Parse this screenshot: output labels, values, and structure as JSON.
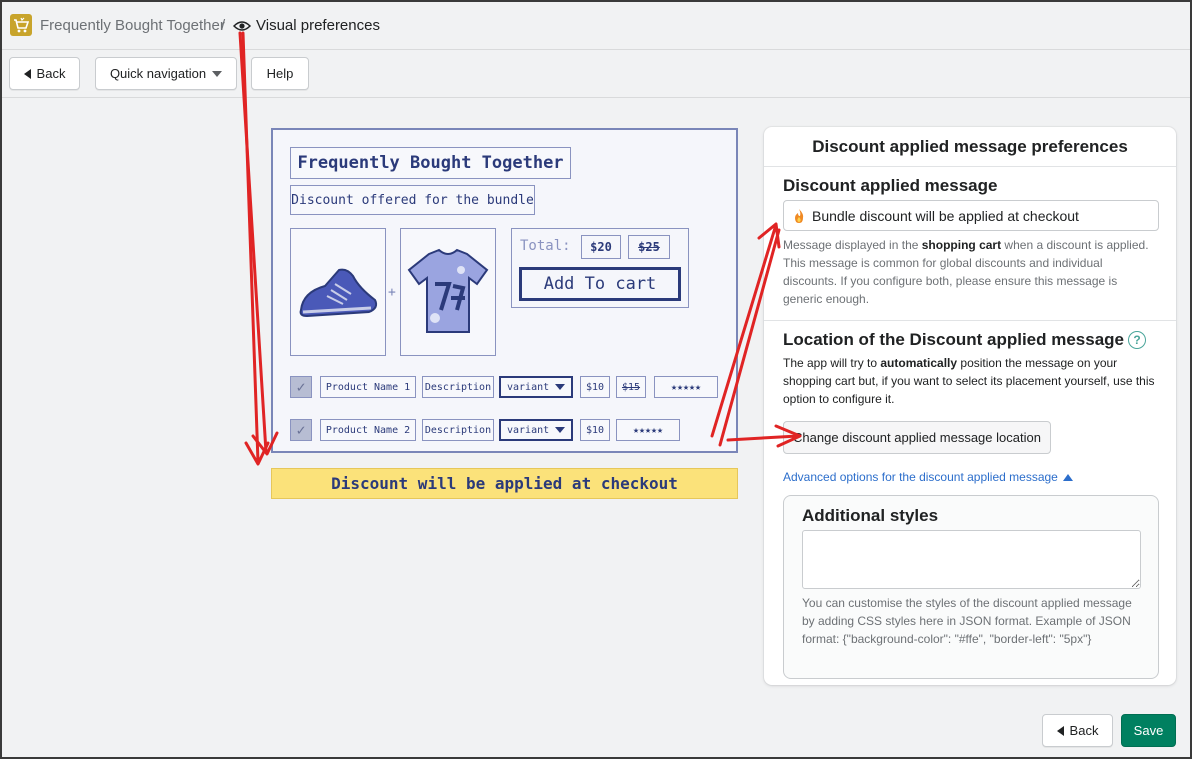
{
  "breadcrumb": {
    "app_name": "Frequently Bought Together",
    "separator": "/",
    "page_name": "Visual preferences"
  },
  "toolbar": {
    "back_label": "Back",
    "quick_nav_label": "Quick navigation",
    "help_label": "Help"
  },
  "preview": {
    "title": "Frequently Bought Together",
    "subtitle": "Discount offered for the bundle",
    "plus": "+",
    "total_label": "Total:",
    "price_new": "$20",
    "price_old": "$25",
    "add_to_cart": "Add To cart",
    "rows": [
      {
        "check": "✓",
        "name": "Product Name 1",
        "desc": "Description",
        "variant": "variant",
        "price": "$10",
        "old_price": "$15",
        "stars": "★★★★★"
      },
      {
        "check": "✓",
        "name": "Product Name 2",
        "desc": "Description",
        "variant": "variant",
        "price": "$10",
        "stars": "★★★★★"
      }
    ],
    "banner": "Discount will be applied at checkout"
  },
  "card": {
    "title": "Discount applied message preferences",
    "message_section_title": "Discount applied message",
    "message_value": "Bundle discount will be applied at checkout",
    "message_help_1": "Message displayed in the ",
    "message_help_bold": "shopping cart",
    "message_help_2": " when a discount is applied. This message is common for global discounts and individual discounts. If you configure both, please ensure this message is generic enough.",
    "location_section_title": "Location of the Discount applied message",
    "location_help_icon": "?",
    "location_text_1": "The app will try to ",
    "location_text_bold": "automatically",
    "location_text_2": " position the message on your shopping cart but, if you want to select its placement yourself, use this option to configure it.",
    "change_location_button": "Change discount applied message location",
    "advanced_link": "Advanced options for the discount applied message",
    "additional_styles_title": "Additional styles",
    "additional_styles_value": "",
    "additional_styles_help": "You can customise the styles of the discount applied message by adding CSS styles here in JSON format. Example of JSON format: {\"background-color\": \"#ffe\", \"border-left\": \"5px\"}"
  },
  "footer": {
    "back_label": "Back",
    "save_label": "Save"
  },
  "colors": {
    "primary": "#008060",
    "link": "#2c6ecb",
    "annotation_arrow": "#e02424",
    "banner_yellow": "#fbe27a"
  },
  "icons": {
    "app_logo": "cart-logo-icon",
    "breadcrumb_page": "eye-icon",
    "back": "triangle-left-icon",
    "quick_nav": "chevron-down-icon",
    "message_emoji": "flame-icon",
    "location_help": "question-circle-icon",
    "advanced": "triangle-up-icon"
  }
}
